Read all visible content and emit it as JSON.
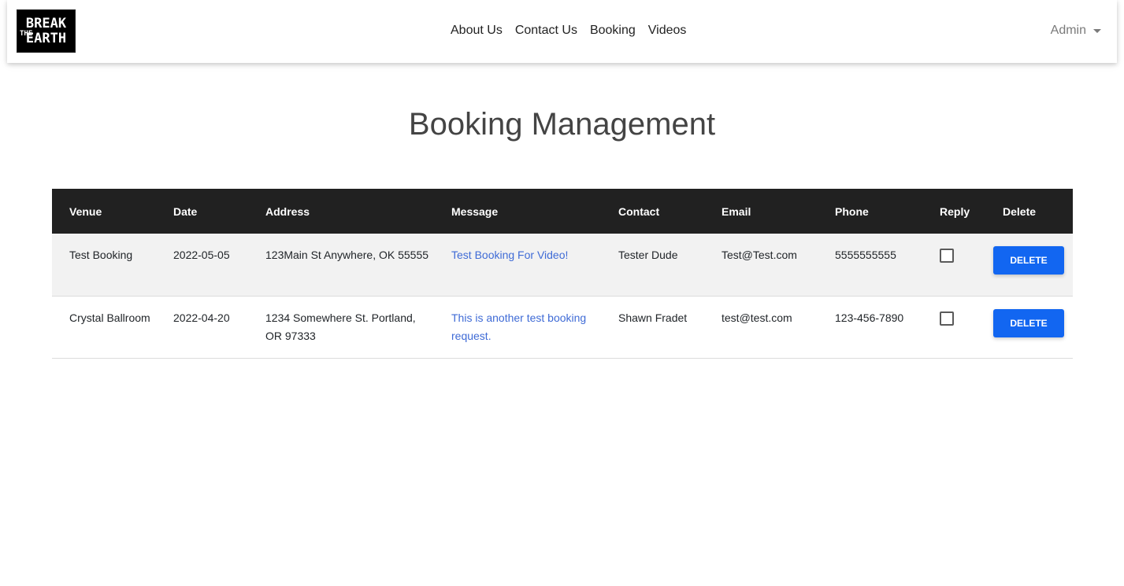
{
  "header": {
    "logo_text_top": "BREAK",
    "logo_text_mid": "THE",
    "logo_text_bottom": "EARTH",
    "nav": [
      "About Us",
      "Contact Us",
      "Booking",
      "Videos"
    ],
    "user_menu": "Admin"
  },
  "page": {
    "title": "Booking Management"
  },
  "table": {
    "columns": [
      "Venue",
      "Date",
      "Address",
      "Message",
      "Contact",
      "Email",
      "Phone",
      "Reply",
      "Delete"
    ],
    "rows": [
      {
        "venue": "Test Booking",
        "date": "2022-05-05",
        "address": "123Main St Anywhere, OK 55555",
        "message": "Test Booking For Video!",
        "contact": "Tester Dude",
        "email": "Test@Test.com",
        "phone": "5555555555",
        "reply": false,
        "delete_label": "DELETE"
      },
      {
        "venue": "Crystal Ballroom",
        "date": "2022-04-20",
        "address": "1234 Somewhere St. Portland, OR 97333",
        "message": "This is another test booking request.",
        "contact": "Shawn Fradet",
        "email": "test@test.com",
        "phone": "123-456-7890",
        "reply": false,
        "delete_label": "DELETE"
      }
    ]
  },
  "colors": {
    "header_bg": "#212121",
    "link": "#3f6bd6",
    "button": "#1266f1",
    "odd_row": "#f2f2f2"
  }
}
